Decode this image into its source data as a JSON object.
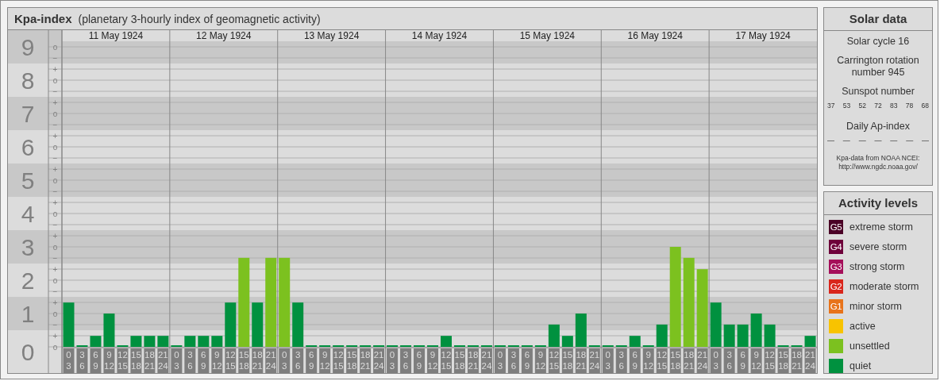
{
  "kpa_panel": {
    "title": "Kpa-index",
    "subtitle": "(planetary 3-hourly index of geomagnetic activity)",
    "days": [
      "11 May 1924",
      "12 May 1924",
      "13 May 1924",
      "14 May 1924",
      "15 May 1924",
      "16 May 1924",
      "17 May 1924"
    ],
    "minor_marks": [
      "o",
      "−",
      "+",
      "o",
      "−",
      "+",
      "o",
      "−",
      "+",
      "o",
      "−",
      "+",
      "o",
      "−",
      "+",
      "o",
      "−",
      "+",
      "o",
      "−",
      "+",
      "o",
      "−",
      "+",
      "o",
      "−",
      "+",
      "o"
    ],
    "chart_data": {
      "type": "bar",
      "stacked": true,
      "grid": true,
      "ylim": [
        0,
        9
      ],
      "yticks": [
        0,
        1,
        2,
        3,
        4,
        5,
        6,
        7,
        8,
        9
      ],
      "categories": [
        "0\n3",
        "3\n6",
        "6\n9",
        "9\n12",
        "12\n15",
        "15\n18",
        "18\n21",
        "21\n24",
        "0\n3",
        "3\n6",
        "6\n9",
        "9\n12",
        "12\n15",
        "15\n18",
        "18\n21",
        "21\n24",
        "0\n3",
        "3\n6",
        "6\n9",
        "9\n12",
        "12\n15",
        "15\n18",
        "18\n21",
        "21\n24",
        "0\n3",
        "3\n6",
        "6\n9",
        "9\n12",
        "12\n15",
        "15\n18",
        "18\n21",
        "21\n24",
        "0\n3",
        "3\n6",
        "6\n9",
        "9\n12",
        "12\n15",
        "15\n18",
        "18\n21",
        "21\n24",
        "0\n3",
        "3\n6",
        "6\n9",
        "9\n12",
        "12\n15",
        "15\n18",
        "18\n21",
        "21\n24",
        "0\n3",
        "3\n6",
        "6\n9",
        "9\n12",
        "12\n15",
        "15\n18",
        "18\n21",
        "21\n24"
      ],
      "series": [
        {
          "color": "#00913f",
          "values": [
            1.33,
            0,
            0.33,
            1,
            0,
            0.33,
            0.33,
            0.33,
            0,
            0.33,
            0.33,
            0.33,
            1.33,
            null,
            1.33,
            null,
            null,
            1.33,
            0,
            0,
            0,
            0,
            0,
            0,
            0,
            0,
            0,
            0,
            0.33,
            0,
            0,
            0,
            0,
            0,
            0,
            0,
            0.67,
            0.33,
            1,
            0,
            0,
            0,
            0.33,
            0,
            0.67,
            null,
            null,
            null,
            1.33,
            0.67,
            0.67,
            1,
            0.67,
            0,
            0,
            0.33
          ]
        },
        {
          "color": "#7cc11f",
          "values": [
            null,
            null,
            null,
            null,
            null,
            null,
            null,
            null,
            null,
            null,
            null,
            null,
            null,
            2.67,
            null,
            2.67,
            2.67,
            null,
            null,
            null,
            null,
            null,
            null,
            null,
            null,
            null,
            null,
            null,
            null,
            null,
            null,
            null,
            null,
            null,
            null,
            null,
            null,
            null,
            null,
            null,
            null,
            null,
            null,
            null,
            null,
            3,
            2.67,
            2.33,
            null,
            null,
            null,
            null,
            null,
            null,
            null,
            null
          ]
        }
      ]
    }
  },
  "solar_data": {
    "title": "Solar data",
    "solar_cycle": "Solar cycle 16",
    "carrington": "Carrington rotation number 945",
    "sunspot_title": "Sunspot number",
    "sunspot_numbers": [
      "37",
      "53",
      "52",
      "72",
      "83",
      "78",
      "68"
    ],
    "ap_title": "Daily Ap-index",
    "ap_values": [
      "—",
      "—",
      "—",
      "—",
      "—",
      "—",
      "—"
    ],
    "source": "Kpa-data from NOAA NCEI:",
    "source_url": "http://www.ngdc.noaa.gov/"
  },
  "activity_levels": {
    "title": "Activity levels",
    "items": [
      {
        "badge": "G5",
        "label": "extreme storm",
        "color": "#4b0026"
      },
      {
        "badge": "G4",
        "label": "severe storm",
        "color": "#6e003a"
      },
      {
        "badge": "G3",
        "label": "strong storm",
        "color": "#a50f5a"
      },
      {
        "badge": "G2",
        "label": "moderate storm",
        "color": "#d9261c"
      },
      {
        "badge": "G1",
        "label": "minor storm",
        "color": "#e8731a"
      },
      {
        "label": "active",
        "color": "#f8c300"
      },
      {
        "label": "unsettled",
        "color": "#7cc11f"
      },
      {
        "label": "quiet",
        "color": "#00913f"
      }
    ]
  }
}
